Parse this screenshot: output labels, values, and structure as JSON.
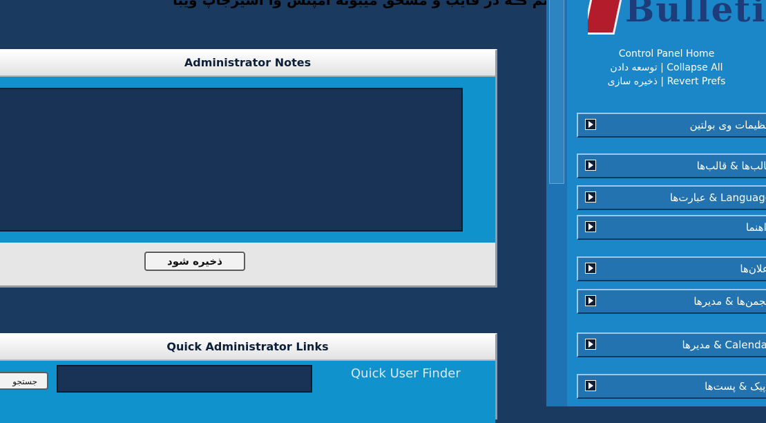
{
  "banner": {
    "text": "اسم ڪه در قايب و مسحق ميبونه امپنس وا اسيرجاپ ويبا"
  },
  "notes_panel": {
    "title": "Administrator Notes",
    "textarea_value": "",
    "save_label": "ذخیره شود"
  },
  "links_panel": {
    "title": "Quick Administrator Links",
    "finder_label": "Quick User Finder",
    "finder_value": "",
    "search_label": "جستجو"
  },
  "sidebar": {
    "logo_text": "Bulletin",
    "cp_home": "Control Panel Home",
    "collapse_all": "Collapse All",
    "expand_all": "توسعه دادن",
    "save_prefs": "ذخیره سازی",
    "revert_prefs": "Revert Prefs",
    "items": [
      {
        "label": "تنظیمات وی بولتین"
      },
      {
        "label": "قالب‌ها & قالب‌ها"
      },
      {
        "label": "Language & عبارت‌ها"
      },
      {
        "label": "راهنما"
      },
      {
        "label": "اعلان‌ها"
      },
      {
        "label": "انجمن‌ها & مدیرها"
      },
      {
        "label": "Calendar & مدیرها"
      },
      {
        "label": "تاپیک & پست‌ها"
      }
    ]
  },
  "colors": {
    "page_bg": "#1b3a5f",
    "panel_body": "#1093cc",
    "sidebar_bg": "#1c87c8",
    "menu_item": "#2373b0"
  }
}
